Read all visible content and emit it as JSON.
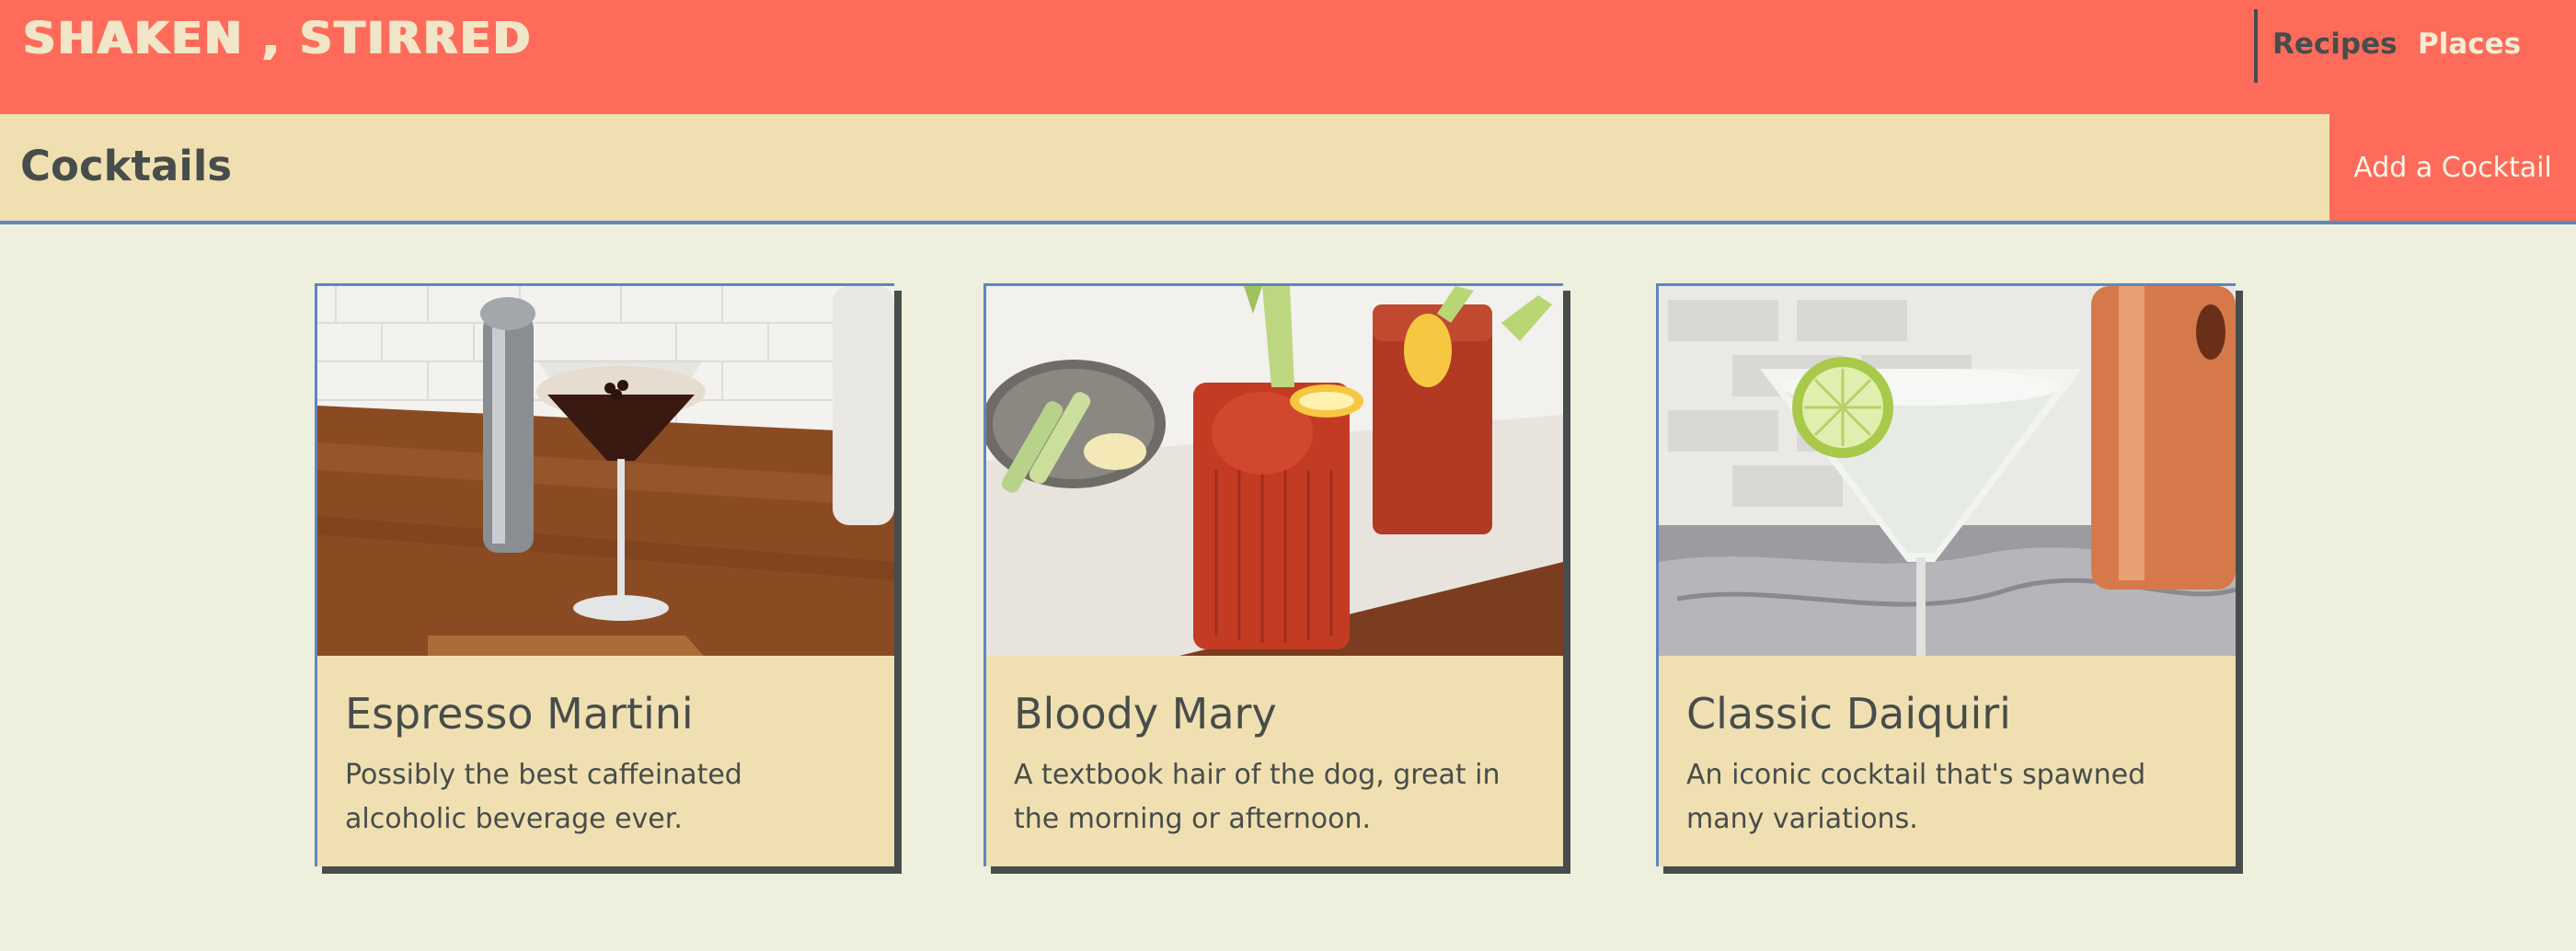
{
  "header": {
    "brand": "SHAKEN , STIRRED",
    "nav": [
      {
        "label": "Recipes"
      },
      {
        "label": "Places"
      }
    ]
  },
  "subheader": {
    "title": "Cocktails",
    "add_button": "Add a Cocktail"
  },
  "cocktails": [
    {
      "name": "Espresso Martini",
      "description": "Possibly the best caffeinated alcoholic beverage ever."
    },
    {
      "name": "Bloody Mary",
      "description": "A textbook hair of the dog, great in the morning or afternoon."
    },
    {
      "name": "Classic Daiquiri",
      "description": "An iconic cocktail that's spawned many variations."
    }
  ],
  "colors": {
    "primary": "#ff6b5a",
    "cream": "#f0e0b1",
    "background": "#eef0dd",
    "text": "#474d4b",
    "accent_border": "#5e86bf"
  }
}
